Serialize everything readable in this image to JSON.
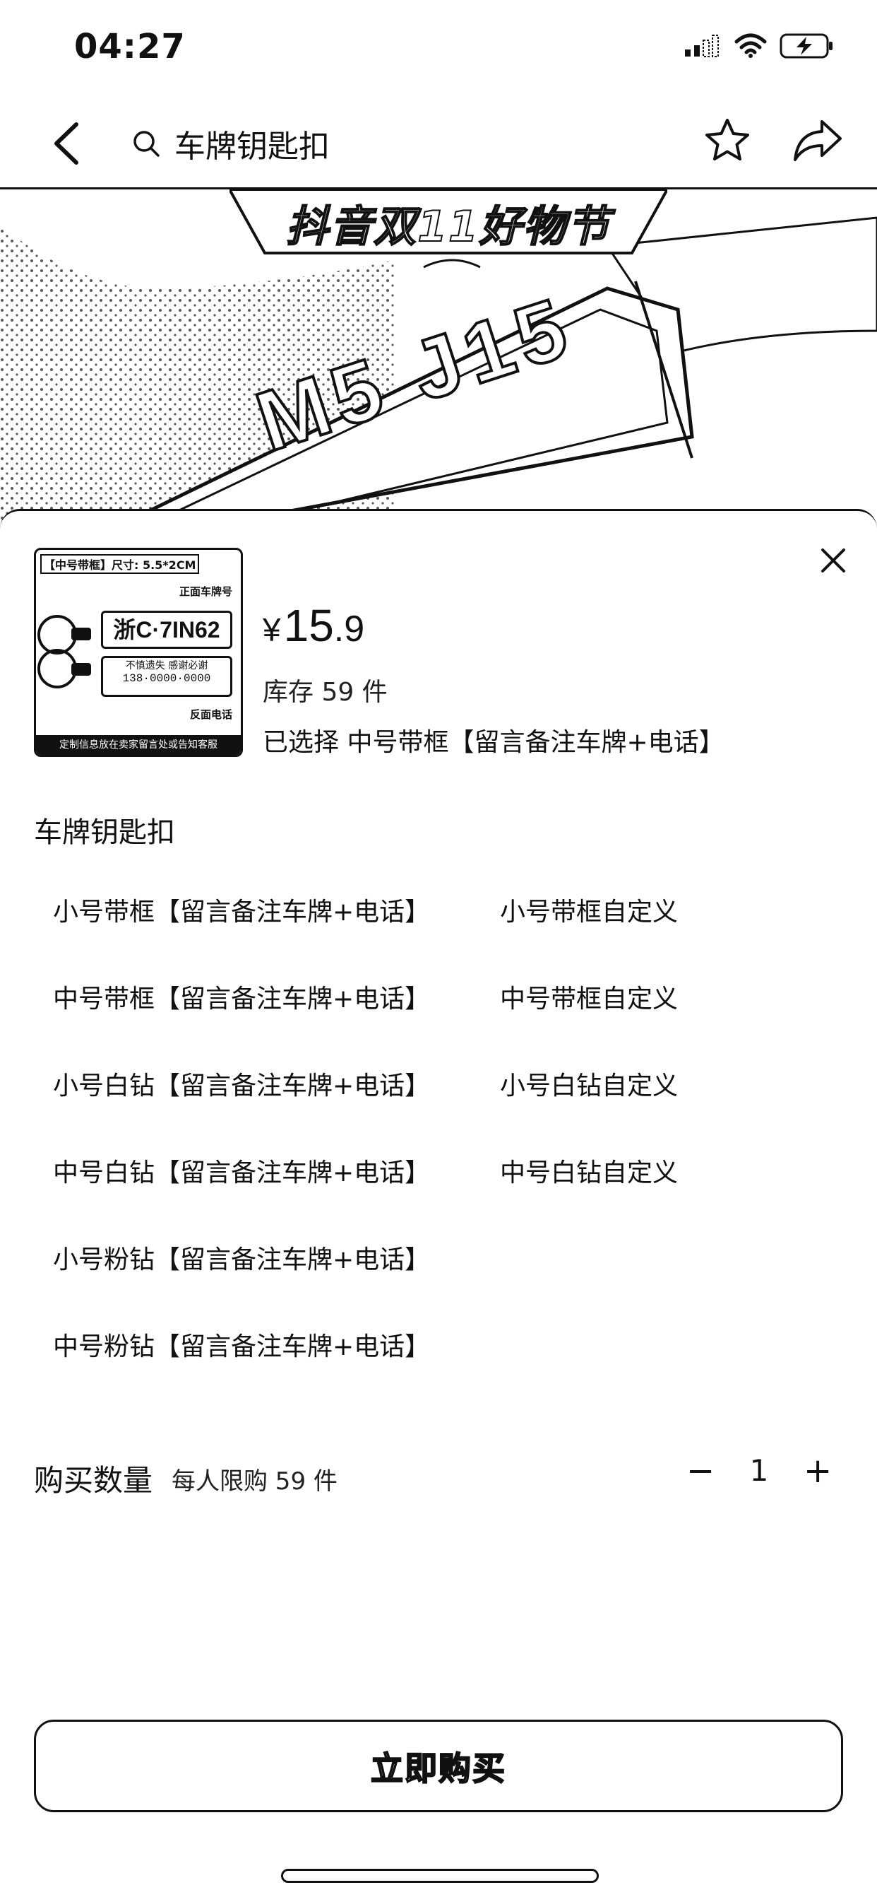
{
  "status_bar": {
    "time": "04:27"
  },
  "nav": {
    "search_query": "车牌钥匙扣"
  },
  "banner": {
    "title": "抖音双11好物节",
    "plate_text": "M5 J15"
  },
  "product": {
    "currency": "¥",
    "price_int": "15",
    "price_dec": ".9",
    "stock": "库存 59 件",
    "selected": "已选择 中号带框【留言备注车牌+电话】"
  },
  "thumbnail": {
    "tag": "【中号带框】尺寸: 5.5*2CM",
    "front_label": "正面车牌号",
    "plate": "浙C·7IN62",
    "back_line1": "不慎遗失  感谢必谢",
    "back_line2": "138·0000·0000",
    "back_label": "反面电话",
    "footer": "定制信息放在卖家留言处或告知客服"
  },
  "options": {
    "section_title": "车牌钥匙扣",
    "items": [
      "小号带框【留言备注车牌+电话】",
      "小号带框自定义",
      "中号带框【留言备注车牌+电话】",
      "中号带框自定义",
      "小号白钻【留言备注车牌+电话】",
      "小号白钻自定义",
      "中号白钻【留言备注车牌+电话】",
      "中号白钻自定义",
      "小号粉钻【留言备注车牌+电话】",
      "中号粉钻【留言备注车牌+电话】"
    ]
  },
  "quantity": {
    "label": "购买数量",
    "limit": "每人限购 59 件",
    "minus": "−",
    "value": "1",
    "plus": "+"
  },
  "buy_button": {
    "label": "立即购买"
  }
}
